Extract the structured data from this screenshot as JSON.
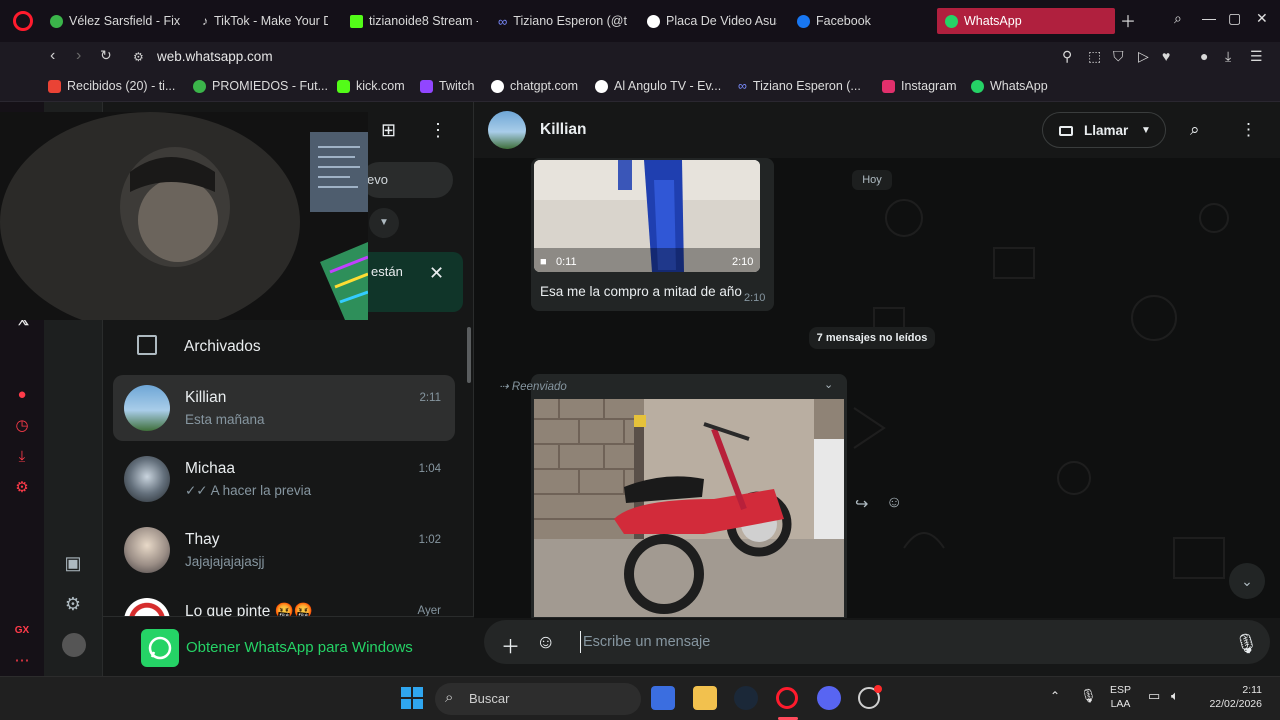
{
  "browser": {
    "tabs": [
      {
        "label": "Vélez Sarsfield - Fixt",
        "color": "#3bb54a"
      },
      {
        "label": "TikTok - Make Your D",
        "color": "#ffffff"
      },
      {
        "label": "tizianoide8 Stream -",
        "color": "#53fc18"
      },
      {
        "label": "Tiziano Esperon (@t",
        "color": "#7b8cff"
      },
      {
        "label": "Placa De Video Asus",
        "color": "#ffffff"
      },
      {
        "label": "Facebook",
        "color": "#1877f2"
      },
      {
        "label": "WhatsApp",
        "color": "#25d366"
      }
    ],
    "url": "web.whatsapp.com",
    "bookmarks": [
      {
        "label": "Recibidos (20) - ti...",
        "color": "#ea4335"
      },
      {
        "label": "PROMIEDOS - Fut...",
        "color": "#3bb54a"
      },
      {
        "label": "kick.com",
        "color": "#53fc18"
      },
      {
        "label": "Twitch",
        "color": "#9146ff"
      },
      {
        "label": "chatgpt.com",
        "color": "#ffffff"
      },
      {
        "label": "Al Angulo TV - Ev...",
        "color": "#ffffff"
      },
      {
        "label": "Tiziano Esperon (...",
        "color": "#7b8cff"
      },
      {
        "label": "Instagram",
        "color": "#e1306c"
      },
      {
        "label": "WhatsApp",
        "color": "#25d366"
      }
    ]
  },
  "sidebar_panel": {
    "new_chat_partial": "evo",
    "notice_partial": "están",
    "archived_label": "Archivados",
    "chats": [
      {
        "name": "Killian",
        "preview": "Esta mañana",
        "time": "2:11"
      },
      {
        "name": "Michaa",
        "preview": "✓✓ A hacer la previa",
        "time": "1:04"
      },
      {
        "name": "Thay",
        "preview": "Jajajajajajasjj",
        "time": "1:02"
      },
      {
        "name": "Lo que pinte 🤬🤬",
        "preview": "",
        "time": "Ayer"
      }
    ],
    "get_app_label": "Obtener WhatsApp para Windows"
  },
  "chat": {
    "contact_name": "Killian",
    "call_label": "Llamar",
    "day_label": "Hoy",
    "video_views": "0:11",
    "video_time": "2:10",
    "message_text": "Esa me la compro a mitad de año",
    "message_time": "2:10",
    "unread_label": "7 mensajes no leídos",
    "forwarded_label": "Reenviado",
    "composer_placeholder": "Escribe un mensaje"
  },
  "taskbar": {
    "search_label": "Buscar",
    "lang_line1": "ESP",
    "lang_line2": "LAA",
    "time": "2:11",
    "date": "22/02/2026"
  },
  "colors": {
    "accent": "#25d366",
    "opera_red": "#ff1b2d",
    "active_tab": "#b0203e"
  }
}
